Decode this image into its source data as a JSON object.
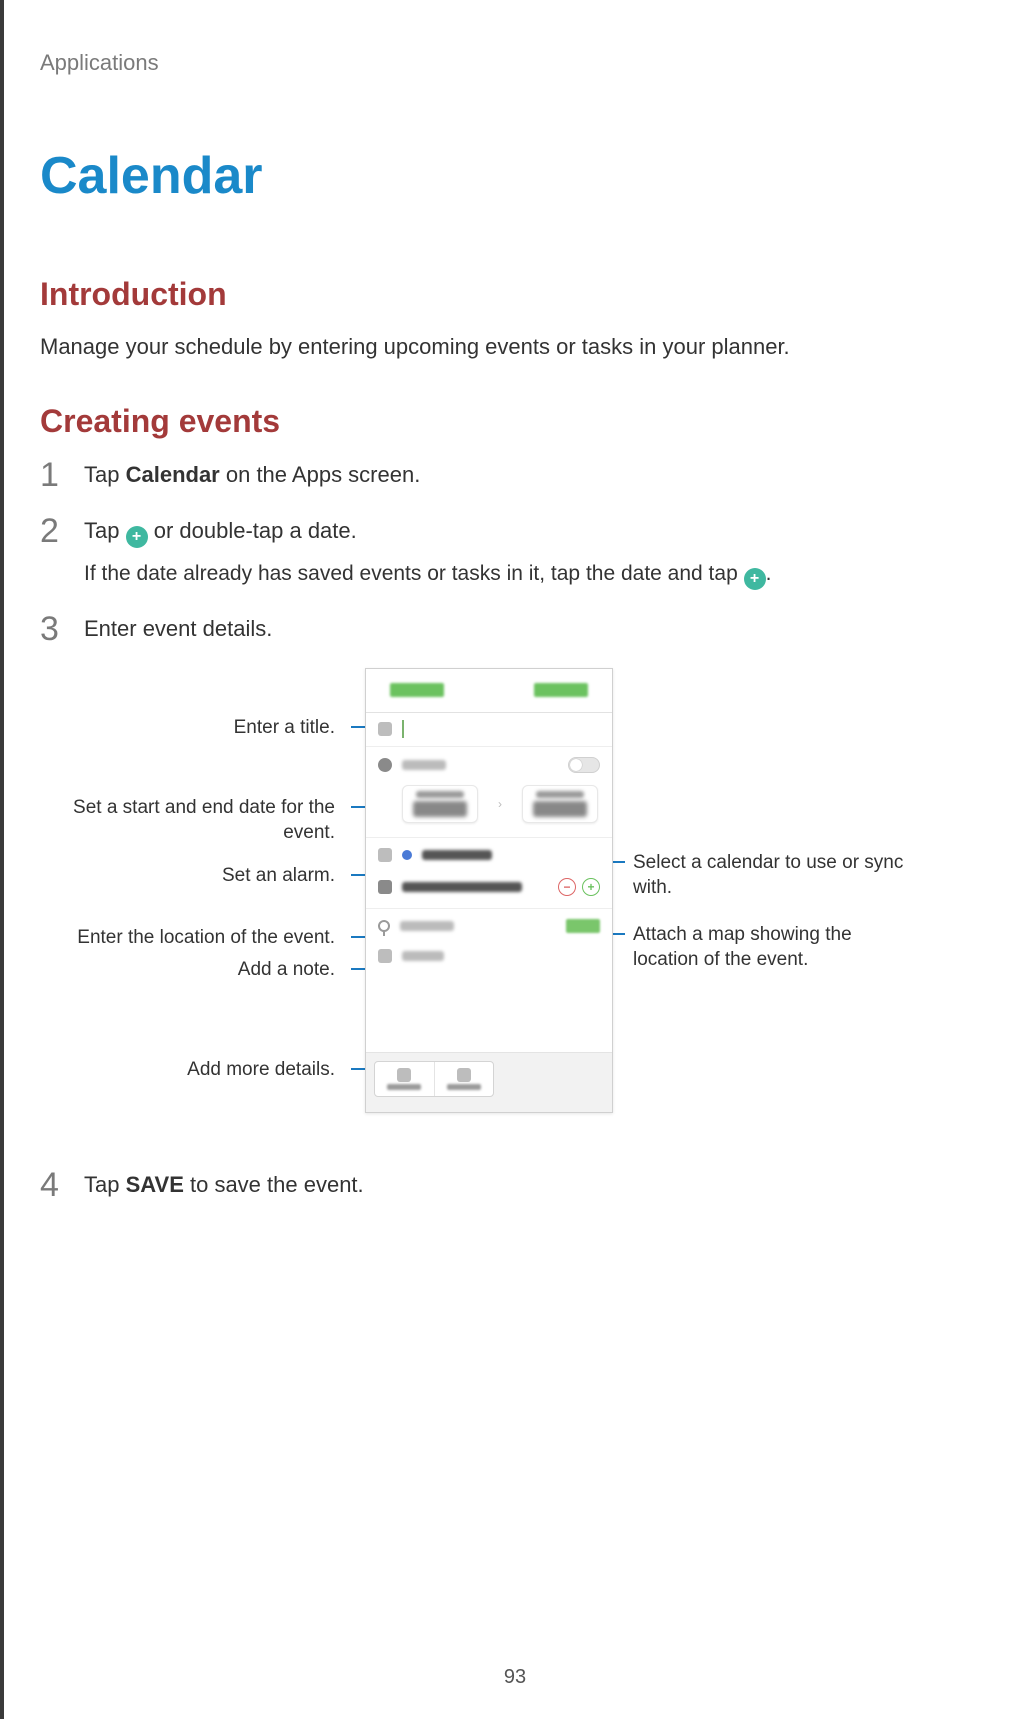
{
  "breadcrumb": "Applications",
  "title": "Calendar",
  "sections": {
    "intro_heading": "Introduction",
    "intro_body": "Manage your schedule by entering upcoming events or tasks in your planner.",
    "create_heading": "Creating events"
  },
  "steps": {
    "s1_num": "1",
    "s1_pre": "Tap ",
    "s1_bold": "Calendar",
    "s1_post": " on the Apps screen.",
    "s2_num": "2",
    "s2_pre": "Tap ",
    "s2_post": " or double-tap a date.",
    "s2_sub_pre": "If the date already has saved events or tasks in it, tap the date and tap ",
    "s2_sub_post": ".",
    "s3_num": "3",
    "s3_body": "Enter event details.",
    "s4_num": "4",
    "s4_pre": "Tap ",
    "s4_bold": "SAVE",
    "s4_post": " to save the event."
  },
  "callouts": {
    "title": "Enter a title.",
    "dates": "Set a start and end date for the event.",
    "alarm": "Set an alarm.",
    "location": "Enter the location of the event.",
    "note": "Add a note.",
    "more": "Add more details.",
    "calendar": "Select a calendar to use or sync with.",
    "map": "Attach a map showing the location of the event."
  },
  "page_number": "93"
}
